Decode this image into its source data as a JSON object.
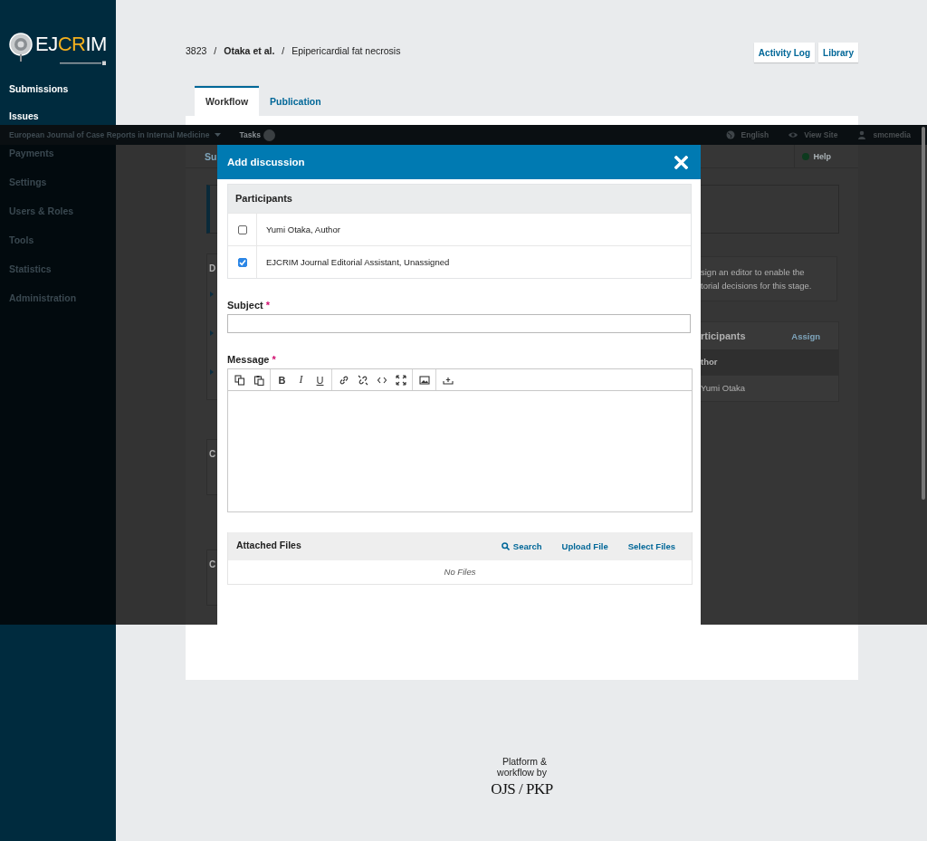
{
  "sidebar": {
    "logo": {
      "parts": [
        {
          "text": "EJ",
          "color": "#ffffff"
        },
        {
          "text": "CR",
          "color": "#f2b01e"
        },
        {
          "text": "IM",
          "color": "#ffffff"
        }
      ]
    },
    "items": [
      {
        "label": "Submissions"
      },
      {
        "label": "Issues"
      }
    ]
  },
  "header": {
    "breadcrumb": [
      {
        "text": "3823",
        "bold": false
      },
      {
        "text": "Otaka et al.",
        "bold": true
      },
      {
        "text": "Epipericardial fat necrosis",
        "bold": false
      }
    ],
    "separators": [
      "/",
      "/"
    ],
    "buttons": [
      "Activity Log",
      "Library"
    ]
  },
  "tabs": [
    {
      "label": "Workflow",
      "selected": true
    },
    {
      "label": "Publication",
      "selected": false
    }
  ],
  "footer": {
    "text_lines": [
      "Platform &",
      "workflow by"
    ],
    "logo": "OJS / PKP"
  },
  "overlay": {
    "top_bar": {
      "journal": "European Journal of Case Reports in Internal Medicine",
      "tasks": "Tasks",
      "links": [
        {
          "label": "English",
          "kind": "language"
        },
        {
          "label": "View Site",
          "kind": "site"
        },
        {
          "label": "smcmedia",
          "kind": "user"
        }
      ]
    },
    "sidebar_items": [
      "Payments",
      "Settings",
      "Users & Roles",
      "Tools",
      "Statistics",
      "Administration"
    ],
    "background": {
      "tab": "Su",
      "help": "Help",
      "left_headings": [
        "D",
        "C",
        "C"
      ],
      "notice_lines": [
        "sign an editor to enable the",
        "torial decisions for this stage."
      ],
      "participants": {
        "title": "rticipants",
        "action": "Assign",
        "group": "thor",
        "member": "Yumi Otaka"
      }
    }
  },
  "modal": {
    "title": "Add discussion",
    "participants": {
      "title": "Participants",
      "rows": [
        {
          "label": "Yumi Otaka, Author",
          "checked": false
        },
        {
          "label": "EJCRIM Journal Editorial Assistant, Unassigned",
          "checked": true
        }
      ]
    },
    "subject": {
      "label": "Subject",
      "required_mark": "*"
    },
    "message": {
      "label": "Message",
      "required_mark": "*",
      "format_buttons": [
        "B",
        "I",
        "U"
      ]
    },
    "attached_files": {
      "title": "Attached Files",
      "actions": [
        {
          "label": "Search",
          "kind": "search"
        },
        {
          "label": "Upload File",
          "kind": "plain"
        },
        {
          "label": "Select Files",
          "kind": "plain"
        }
      ],
      "empty": "No Files"
    }
  }
}
